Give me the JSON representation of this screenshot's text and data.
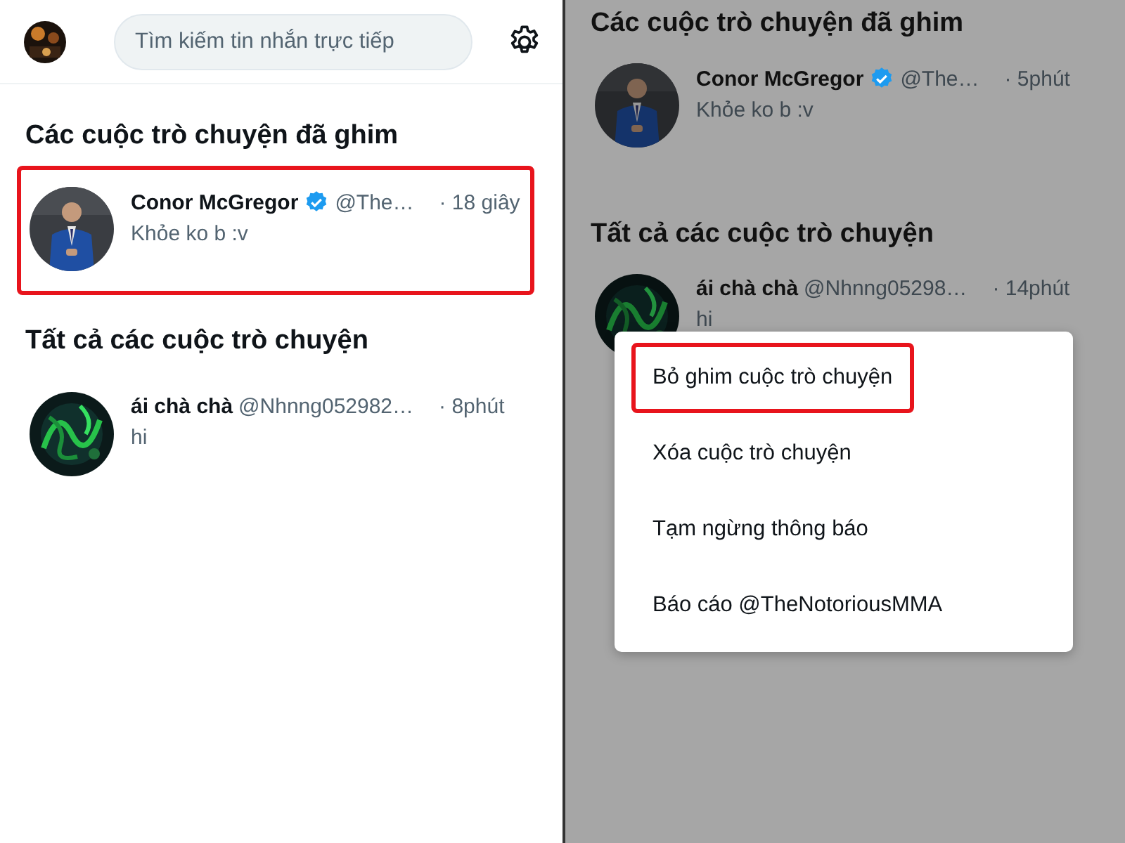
{
  "panels": [
    {
      "dimmed": false,
      "header": {
        "search": {
          "placeholder": "Tìm kiếm tin nhắn trực tiếp"
        }
      },
      "sections": [
        {
          "title": "Các cuộc trò chuyện đã ghim",
          "chats": [
            {
              "name": "Conor McGregor",
              "verified": true,
              "handle": "@The…",
              "time": "· 18 giây",
              "message": "Khỏe ko b :v",
              "highlighted": true
            }
          ]
        },
        {
          "title": "Tất cả các cuộc trò chuyện",
          "chats": [
            {
              "name": "ái chà chà",
              "verified": false,
              "handle": "@Nhnng052982…",
              "time": "· 8phút",
              "message": "hi",
              "highlighted": false
            }
          ]
        }
      ]
    },
    {
      "dimmed": true,
      "sections": [
        {
          "title": "Các cuộc trò chuyện đã ghim",
          "chats": [
            {
              "name": "Conor McGregor",
              "verified": true,
              "handle": "@The…",
              "time": "· 5phút",
              "message": "Khỏe ko b :v",
              "highlighted": false
            }
          ]
        },
        {
          "title": "Tất cả các cuộc trò chuyện",
          "chats": [
            {
              "name": "ái chà chà",
              "verified": false,
              "handle": "@Nhnng05298…",
              "time": "· 14phút",
              "message": "hi",
              "highlighted": false
            }
          ]
        }
      ],
      "menu": {
        "items": [
          {
            "label": "Bỏ ghim cuộc trò chuyện",
            "highlighted": true
          },
          {
            "label": "Xóa cuộc trò chuyện",
            "highlighted": false
          },
          {
            "label": "Tạm ngừng thông báo",
            "highlighted": false
          },
          {
            "label": "Báo cáo @TheNotoriousMMA",
            "highlighted": false
          }
        ]
      }
    }
  ]
}
